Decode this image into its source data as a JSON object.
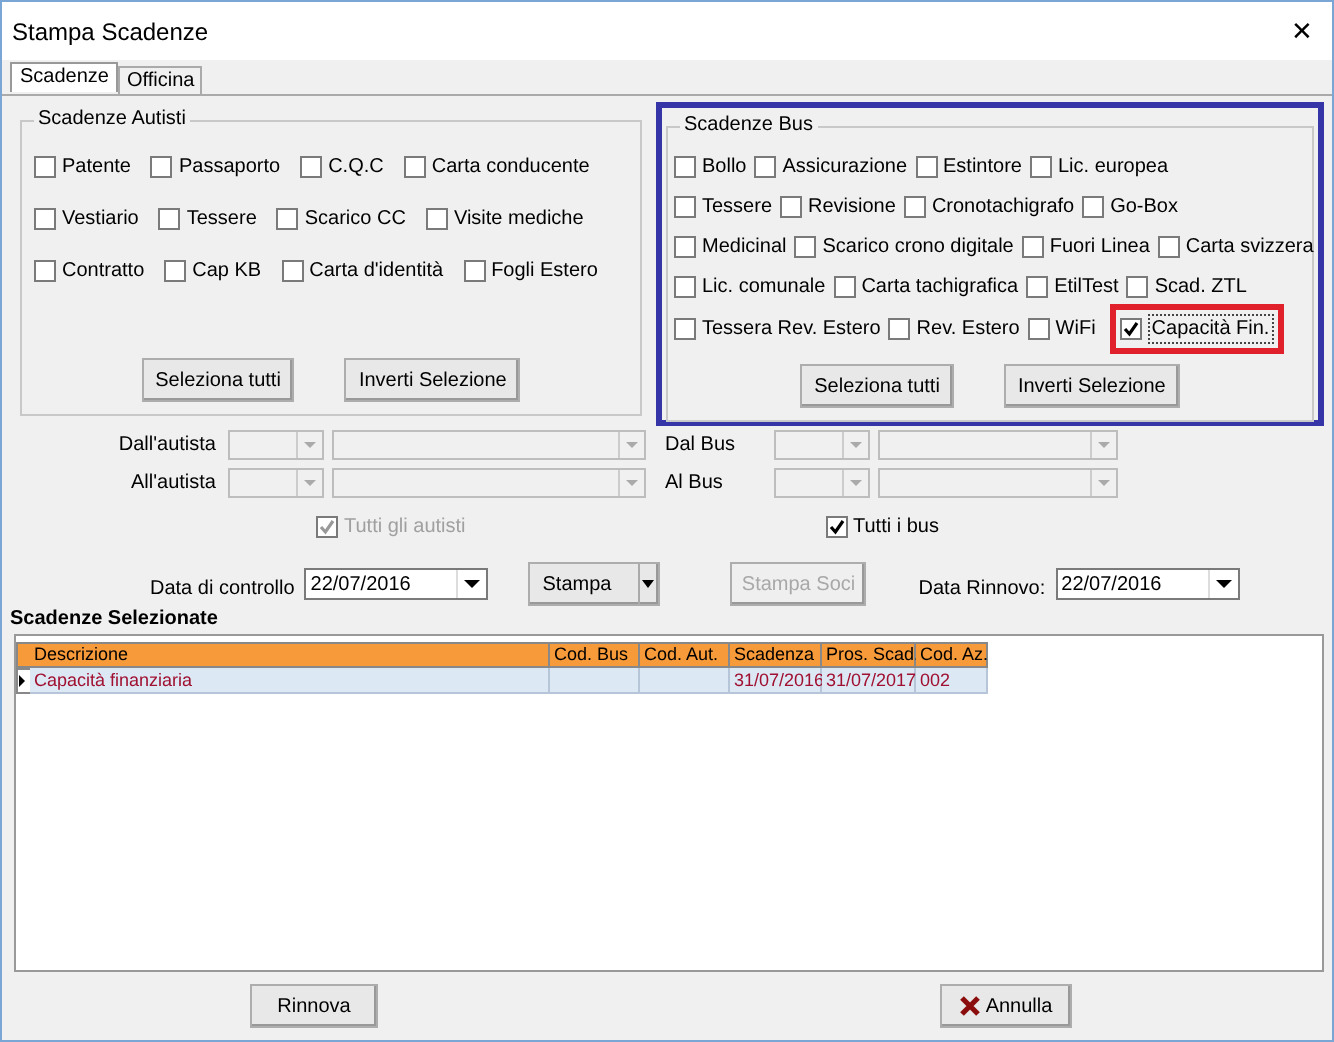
{
  "window": {
    "title": "Stampa Scadenze",
    "close": "✕"
  },
  "tabs": [
    {
      "label": "Scadenze",
      "selected": true
    },
    {
      "label": "Officina",
      "selected": false
    }
  ],
  "driver_group": {
    "title": "Scadenze Autisti",
    "rows": [
      [
        {
          "label": "Patente",
          "checked": false
        },
        {
          "label": "Passaporto",
          "checked": false
        },
        {
          "label": "C.Q.C",
          "checked": false
        },
        {
          "label": "Carta conducente",
          "checked": false
        }
      ],
      [
        {
          "label": "Vestiario",
          "checked": false
        },
        {
          "label": "Tessere",
          "checked": false
        },
        {
          "label": "Scarico CC",
          "checked": false
        },
        {
          "label": "Visite mediche",
          "checked": false
        }
      ],
      [
        {
          "label": "Contratto",
          "checked": false
        },
        {
          "label": "Cap KB",
          "checked": false
        },
        {
          "label": "Carta d'identità",
          "checked": false
        },
        {
          "label": "Fogli Estero",
          "checked": false
        }
      ]
    ],
    "buttons": [
      "Seleziona tutti",
      "Inverti Selezione"
    ]
  },
  "bus_group": {
    "title": "Scadenze Bus",
    "highlighted": true,
    "rows": [
      [
        {
          "label": "Bollo",
          "checked": false,
          "highlighted": false
        },
        {
          "label": "Assicurazione",
          "checked": false,
          "highlighted": false
        },
        {
          "label": "Estintore",
          "checked": false,
          "highlighted": false
        },
        {
          "label": "Lic. europea",
          "checked": false,
          "highlighted": false
        }
      ],
      [
        {
          "label": "Tessere",
          "checked": false,
          "highlighted": false
        },
        {
          "label": "Revisione",
          "checked": false,
          "highlighted": false
        },
        {
          "label": "Cronotachigrafo",
          "checked": false,
          "highlighted": false
        },
        {
          "label": "Go-Box",
          "checked": false,
          "highlighted": false
        }
      ],
      [
        {
          "label": "Medicinal",
          "checked": false,
          "highlighted": false
        },
        {
          "label": "Scarico crono digitale",
          "checked": false,
          "highlighted": false
        },
        {
          "label": "Fuori Linea",
          "checked": false,
          "highlighted": false
        },
        {
          "label": "Carta svizzera",
          "checked": false,
          "highlighted": false
        }
      ],
      [
        {
          "label": "Lic. comunale",
          "checked": false,
          "highlighted": false
        },
        {
          "label": "Carta tachigrafica",
          "checked": false,
          "highlighted": false
        },
        {
          "label": "EtilTest",
          "checked": false,
          "highlighted": false
        },
        {
          "label": "Scad. ZTL",
          "checked": false,
          "highlighted": false
        }
      ],
      [
        {
          "label": "Tessera Rev. Estero",
          "checked": false,
          "highlighted": false
        },
        {
          "label": "Rev. Estero",
          "checked": false,
          "highlighted": false
        },
        {
          "label": "WiFi",
          "checked": false,
          "highlighted": false
        },
        {
          "label": "Capacità Fin.",
          "checked": true,
          "highlighted": true
        }
      ]
    ],
    "buttons": [
      "Seleziona tutti",
      "Inverti Selezione"
    ]
  },
  "filters": {
    "driver_from": "Dall'autista",
    "driver_to": "All'autista",
    "bus_from": "Dal Bus",
    "bus_to": "Al Bus",
    "all_drivers": {
      "label": "Tutti gli autisti",
      "checked": true,
      "disabled": true
    },
    "all_buses": {
      "label": "Tutti i bus",
      "checked": true,
      "disabled": false
    }
  },
  "control": {
    "date_label": "Data di controllo",
    "date": "22/07/2016",
    "print": "Stampa",
    "print_members": {
      "label": "Stampa Soci",
      "disabled": true
    },
    "renew_label": "Data Rinnovo:",
    "renew_date": "22/07/2016"
  },
  "table": {
    "title": "Scadenze Selezionate",
    "columns": [
      "Descrizione",
      "Cod. Bus",
      "Cod. Aut.",
      "Scadenza",
      "Pros. Scad.",
      "Cod. Az."
    ],
    "rows": [
      [
        "Capacità finanziaria",
        "",
        "",
        "31/07/2016",
        "31/07/2017",
        "002"
      ]
    ]
  },
  "footer": {
    "renew": "Rinnova",
    "cancel": "Annulla"
  }
}
